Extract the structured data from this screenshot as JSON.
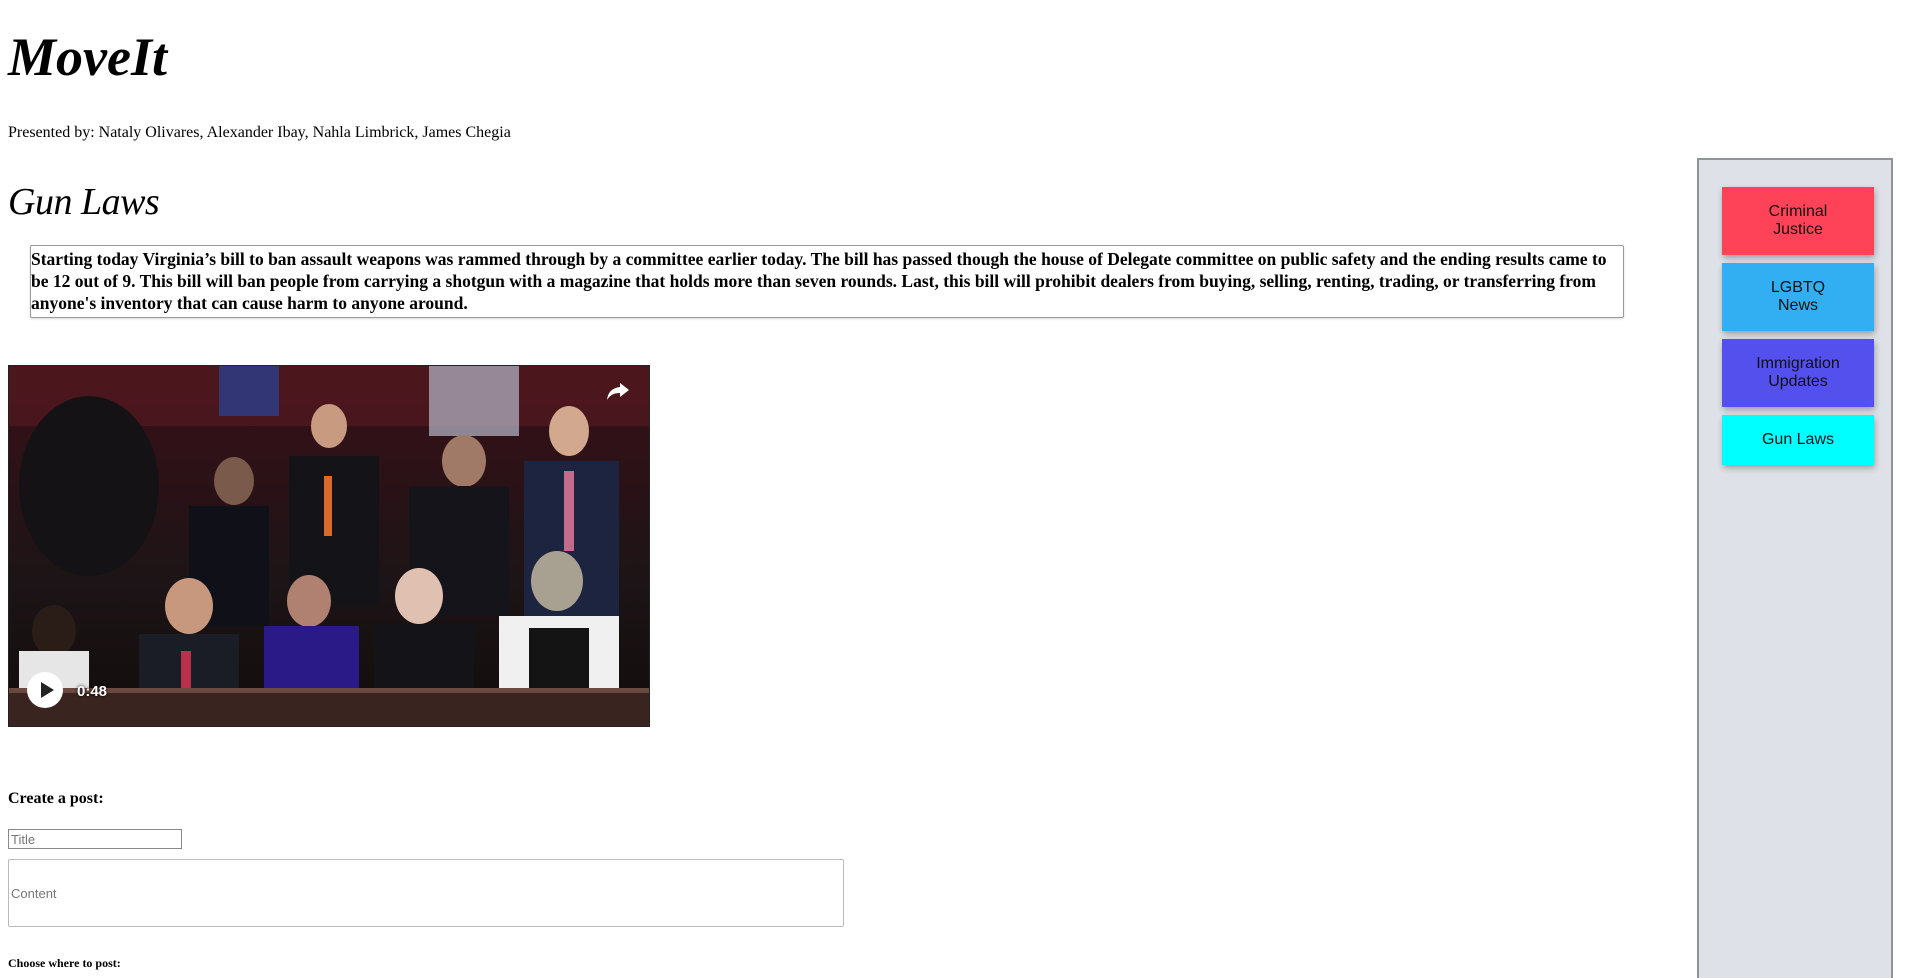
{
  "site": {
    "title": "MoveIt",
    "presenters": "Presented by: Nataly Olivares, Alexander Ibay, Nahla Limbrick, James Chegia"
  },
  "page": {
    "heading": "Gun Laws",
    "article": "Starting today Virginia’s bill to ban assault weapons was rammed through by a committee earlier today. The bill has passed though the house of Delegate committee on public safety and the ending results came to be 12 out of 9. This bill will ban people from carrying a shotgun with a magazine that holds more than seven rounds. Last, this bill will prohibit dealers from buying, selling, renting, trading, or transferring from anyone's inventory that can cause harm to anyone around."
  },
  "video": {
    "duration": "0:48",
    "play_icon": "play-icon",
    "share_icon": "share-icon"
  },
  "post_form": {
    "label": "Create a post:",
    "title_placeholder": "Title",
    "content_placeholder": "Content",
    "choose_label": "Choose where to post:"
  },
  "sidebar": {
    "items": [
      {
        "label": "Criminal\nJustice",
        "color": "#fe4358"
      },
      {
        "label": "LGBTQ\nNews",
        "color": "#32aef2"
      },
      {
        "label": "Immigration\nUpdates",
        "color": "#5350ed"
      },
      {
        "label": "Gun Laws",
        "color": "#00ffff"
      }
    ]
  }
}
